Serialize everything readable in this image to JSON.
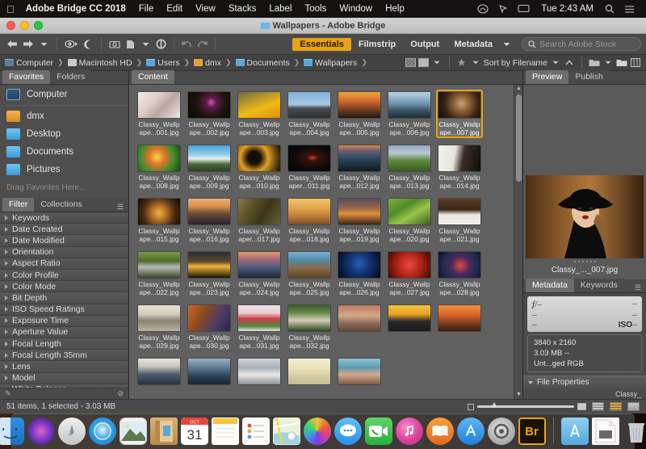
{
  "menubar": {
    "apple_icon": "apple-logo",
    "app_name": "Adobe Bridge CC 2018",
    "menus": [
      "File",
      "Edit",
      "View",
      "Stacks",
      "Label",
      "Tools",
      "Window",
      "Help"
    ],
    "status_icons": [
      "creative-cloud-icon",
      "pointer-icon",
      "airplay-icon"
    ],
    "clock": "Tue 2:43 AM",
    "search_icon": "spotlight-search-icon",
    "control_center_icon": "notification-center-icon"
  },
  "window": {
    "title": "Wallpapers - Adobe Bridge",
    "traffic_lights": [
      "close",
      "minimize",
      "zoom"
    ]
  },
  "toolbar": {
    "back_icon": "arrow-left-icon",
    "forward_icon": "arrow-right-icon",
    "recent_icon": "chevron-down-icon",
    "reveal_icon": "eye-icon",
    "boost_icon": "moon-icon",
    "camera_icon": "get-photos-camera-icon",
    "refine_icon": "refine-page-icon",
    "rotate_ccw_icon": "rotate-counterclockwise-icon",
    "rotate_cw_icon": "rotate-clockwise-icon",
    "undo_icon": "undo-arrow-icon",
    "redo_icon": "redo-arrow-icon",
    "workspaces": [
      "Essentials",
      "Filmstrip",
      "Output",
      "Metadata"
    ],
    "active_workspace": "Essentials",
    "workspace_more_icon": "chevron-down-icon",
    "search_placeholder": "Search Adobe Stock",
    "search_icon": "magnifier-icon",
    "search_value": ""
  },
  "breadcrumb": {
    "items": [
      {
        "label": "Computer",
        "icon": "computer-icon"
      },
      {
        "label": "Macintosh HD",
        "icon": "harddisk-icon"
      },
      {
        "label": "Users",
        "icon": "folder-icon"
      },
      {
        "label": "dmx",
        "icon": "home-icon"
      },
      {
        "label": "Documents",
        "icon": "folder-icon"
      },
      {
        "label": "Wallpapers",
        "icon": "folder-icon"
      }
    ],
    "separator": "❯",
    "tools": {
      "thumbnail_quality_icon": "checkered-thumbnail-icon",
      "preview_mode_icon": "preview-square-icon",
      "preview_dropdown_icon": "chevron-down-icon",
      "rating_icon": "star-filter-icon",
      "rating_dropdown_icon": "chevron-down-icon",
      "sort_label": "Sort by Filename",
      "sort_dropdown_icon": "chevron-down-icon",
      "sort_direction_icon": "chevron-up-icon",
      "new_folder_icon": "new-folder-icon",
      "new_folder_dropdown_icon": "chevron-down-icon",
      "open_folder_icon": "open-folder-icon",
      "grid_toggle_icon": "grid-layout-icon"
    }
  },
  "favorites_panel": {
    "tabs": [
      "Favorites",
      "Folders"
    ],
    "active_tab": "Favorites",
    "items": [
      {
        "label": "Computer",
        "icon": "computer-icon"
      },
      {
        "label": "dmx",
        "icon": "home-icon"
      },
      {
        "label": "Desktop",
        "icon": "folder-icon"
      },
      {
        "label": "Documents",
        "icon": "folder-icon"
      },
      {
        "label": "Pictures",
        "icon": "folder-icon"
      }
    ],
    "drag_hint": "Drag Favorites Here..."
  },
  "filter_panel": {
    "tabs": [
      "Filter",
      "Collections"
    ],
    "active_tab": "Filter",
    "menu_icon": "panel-menu-icon",
    "items": [
      "Keywords",
      "Date Created",
      "Date Modified",
      "Orientation",
      "Aspect Ratio",
      "Color Profile",
      "Color Mode",
      "Bit Depth",
      "ISO Speed Ratings",
      "Exposure Time",
      "Aperture Value",
      "Focal Length",
      "Focal Length 35mm",
      "Lens",
      "Model",
      "White Balance"
    ],
    "footer": {
      "keep_filter_icon": "pin-filter-icon",
      "clear_filter_icon": "clear-filter-icon"
    }
  },
  "content_panel": {
    "tabs": [
      "Content"
    ],
    "active_tab": "Content",
    "selected_file": "Classy_Wallpape...007.jpg",
    "scrollbar": {
      "up_icon": "scroll-up-arrow-icon",
      "down_icon": "scroll-down-arrow-icon"
    },
    "files": [
      {
        "name_line1": "Classy_Wallp",
        "name_line2": "ape...001.jpg",
        "selected": false,
        "thumb": "linear-gradient(135deg,#f4e9e4 0%,#ded0ca 35%,#b9a79f 60%,#efe7e2 100%)"
      },
      {
        "name_line1": "Classy_Wallp",
        "name_line2": "ape...002.jpg",
        "selected": false,
        "thumb": "radial-gradient(circle at 55% 40%,#d14fb0 0%,#5c1c4a 18%,#1a1208 55%,#0a0805 100%)"
      },
      {
        "name_line1": "Classy_Wallp",
        "name_line2": "ape...003.jpg",
        "selected": false,
        "thumb": "linear-gradient(160deg,#6f6a3c 0%,#b89a2a 35%,#f2b915 60%,#d98f08 100%)"
      },
      {
        "name_line1": "Classy_Wallp",
        "name_line2": "ape...004.jpg",
        "selected": false,
        "thumb": "linear-gradient(#7fb3d8 0%,#a8c9e2 48%,#4a4f54 62%,#2b2f33 100%)"
      },
      {
        "name_line1": "Classy_Wallp",
        "name_line2": "ape...005.jpg",
        "selected": false,
        "thumb": "linear-gradient(#f2a33c 0%,#c9622a 40%,#6b3a20 70%,#231711 100%)"
      },
      {
        "name_line1": "Classy_Wallp",
        "name_line2": "ape...006.jpg",
        "selected": false,
        "thumb": "linear-gradient(#b8d6e8 0%,#6f93ad 45%,#3d5668 70%,#1d2b35 100%)"
      },
      {
        "name_line1": "Classy_Wallp",
        "name_line2": "ape...007.jpg",
        "selected": true,
        "thumb": "radial-gradient(circle at 55% 45%,#c9a276 0%,#8a5f35 30%,#3a2416 62%,#120b05 100%)"
      },
      {
        "name_line1": "Classy_Wallp",
        "name_line2": "ape...008.jpg",
        "selected": false,
        "thumb": "radial-gradient(circle at 45% 45%,#f2d83c 0%,#e0732a 30%,#3f8f2c 62%,#1d3f14 100%)"
      },
      {
        "name_line1": "Classy_Wallp",
        "name_line2": "ape...009.jpg",
        "selected": false,
        "thumb": "linear-gradient(#4a9fd8 0%,#9fd0ea 38%,#e8eef2 52%,#4f6b3f 72%,#2b3d22 100%)"
      },
      {
        "name_line1": "Classy_Wallp",
        "name_line2": "ape...010.jpg",
        "selected": false,
        "thumb": "radial-gradient(circle at 38% 48%,#0a0a0a 0%,#1a1106 22%,#e0a024 48%,#6b4a10 75%,#140d04 100%)"
      },
      {
        "name_line1": "Classy_Wallp",
        "name_line2": "aper...011.jpg",
        "selected": false,
        "thumb": "radial-gradient(ellipse at 58% 48%,#cf3b2a 0%,#3a1208 16%,#0a0a0a 60%,#050505 100%)"
      },
      {
        "name_line1": "Classy_Wallp",
        "name_line2": "ape...012.jpg",
        "selected": false,
        "thumb": "linear-gradient(#d4884a 0%,#6a5a7a 22%,#2f4a5c 48%,#1d3340 72%,#0f1a22 100%)"
      },
      {
        "name_line1": "Classy_Wallp",
        "name_line2": "ape...013.jpg",
        "selected": false,
        "thumb": "linear-gradient(#8fa8bc 0%,#b9c8d4 30%,#5f8a3c 58%,#3a5a26 100%)"
      },
      {
        "name_line1": "Classy_Wallp",
        "name_line2": "ape...014.jpg",
        "selected": false,
        "thumb": "linear-gradient(100deg,#f2f2ee 0%,#e8e4dc 38%,#3a2d24 58%,#120d09 100%)"
      },
      {
        "name_line1": "Classy_Wallp",
        "name_line2": "ape...015.jpg",
        "selected": false,
        "thumb": "radial-gradient(circle at 50% 55%,#f0b63c 0%,#b9702a 28%,#4a2c12 62%,#120a04 100%)"
      },
      {
        "name_line1": "Classy_Wallp",
        "name_line2": "ape...016.jpg",
        "selected": false,
        "thumb": "linear-gradient(#e8b27a 0%,#d98f4a 30%,#6a4a3a 58%,#2b2430 100%)"
      },
      {
        "name_line1": "Classy_Wallp",
        "name_line2": "aper...017.jpg",
        "selected": false,
        "thumb": "linear-gradient(120deg,#8a7a4a 0%,#5f5228 30%,#3a3418 60%,#6b5f33 100%)"
      },
      {
        "name_line1": "Classy_Wallp",
        "name_line2": "ape...018.jpg",
        "selected": false,
        "thumb": "linear-gradient(#f0c46a 0%,#e0a04a 40%,#b97a3a 70%,#7a5228 100%)"
      },
      {
        "name_line1": "Classy_Wallp",
        "name_line2": "ape...019.jpg",
        "selected": false,
        "thumb": "linear-gradient(#5a4a5f 0%,#9a6a4a 38%,#e0903c 58%,#3a2418 100%)"
      },
      {
        "name_line1": "Classy_Wallp",
        "name_line2": "ape...020.jpg",
        "selected": false,
        "thumb": "linear-gradient(150deg,#7ab03c 0%,#4f8a2a 35%,#9ac44a 60%,#3a5f1d 100%)"
      },
      {
        "name_line1": "Classy_Wallp",
        "name_line2": "ape...021.jpg",
        "selected": false,
        "thumb": "linear-gradient(#5f3f28 0%,#3a2416 42%,#e8e4de 62%,#f2f0ec 100%)"
      },
      {
        "name_line1": "Classy_Wallp",
        "name_line2": "ape...022.jpg",
        "selected": false,
        "thumb": "linear-gradient(#7a9a4a 0%,#4f6b2a 35%,#b9b9b9 58%,#3a4a22 100%)"
      },
      {
        "name_line1": "Classy_Wallp",
        "name_line2": "ape...023.jpg",
        "selected": false,
        "thumb": "linear-gradient(#2b2b33 0%,#5f4a2a 38%,#f0b63c 55%,#1a1408 100%)"
      },
      {
        "name_line1": "Classy_Wallp",
        "name_line2": "ape...024.jpg",
        "selected": false,
        "thumb": "linear-gradient(#e09a6a 0%,#a06a7a 30%,#4a5a7a 62%,#1d2833 100%)"
      },
      {
        "name_line1": "Classy_Wallp",
        "name_line2": "ape...025.jpg",
        "selected": false,
        "thumb": "linear-gradient(#7ab0d4 0%,#4f8aa8 32%,#8a6a4a 62%,#5f4428 100%)"
      },
      {
        "name_line1": "Classy_Wallp",
        "name_line2": "ape...026.jpg",
        "selected": false,
        "thumb": "radial-gradient(circle at 50% 45%,#2a5fb0 0%,#153a7a 35%,#0a1a3f 75%,#050a1a 100%)"
      },
      {
        "name_line1": "Classy_Wallp",
        "name_line2": "ape...027.jpg",
        "selected": false,
        "thumb": "radial-gradient(circle at 50% 50%,#e84a3c 0%,#b92a1d 40%,#7a140a 75%,#3a0805 100%)"
      },
      {
        "name_line1": "Classy_Wallp",
        "name_line2": "ape...028.jpg",
        "selected": false,
        "thumb": "radial-gradient(circle at 52% 52%,#e84a3c 0%,#4a2a5f 35%,#1d2a4a 70%,#0a1022 100%)"
      },
      {
        "name_line1": "Classy_Wallp",
        "name_line2": "ape...029.jpg",
        "selected": false,
        "thumb": "linear-gradient(#e8e2d4 0%,#d4ccb9 35%,#8a8272 60%,#b9b2a0 100%)"
      },
      {
        "name_line1": "Classy_Wallp",
        "name_line2": "ape...030.jpg",
        "selected": false,
        "thumb": "linear-gradient(120deg,#c96a2a 0%,#8a4a1d 35%,#4a3a6b 70%,#2b2440 100%)"
      },
      {
        "name_line1": "Classy_Wallp",
        "name_line2": "ape...031.jpg",
        "selected": false,
        "thumb": "linear-gradient(#f2e4e8 0%,#e8ccd4 30%,#d43c4a 52%,#4a8a3c 80%,#f0e0e4 100%)"
      },
      {
        "name_line1": "Classy_Wallp",
        "name_line2": "ape...032.jpg",
        "selected": false,
        "thumb": "linear-gradient(#3a5f2a 0%,#6b8a4a 30%,#d4ccb9 58%,#2b4a1d 100%)"
      },
      {
        "name_line1": "",
        "name_line2": "",
        "selected": false,
        "thumb": "linear-gradient(#b97a5f 0%,#d4a88a 40%,#8a6a5a 70%,#5f4a3c 100%)"
      },
      {
        "name_line1": "",
        "name_line2": "",
        "selected": false,
        "thumb": "linear-gradient(#f2c43c 0%,#e8a024 35%,#2b2b2b 62%,#1a1a1a 100%)"
      },
      {
        "name_line1": "",
        "name_line2": "",
        "selected": false,
        "thumb": "linear-gradient(#f0903c 0%,#d4622a 38%,#7a3a1d 70%,#3a1d0f 100%)"
      },
      {
        "name_line1": "",
        "name_line2": "",
        "selected": false,
        "thumb": "linear-gradient(#e8e4dc 0%,#c9c4b9 30%,#4a5a6b 62%,#2b3440 100%)"
      },
      {
        "name_line1": "",
        "name_line2": "",
        "selected": false,
        "thumb": "linear-gradient(#9ab0c4 0%,#5f7a94 35%,#2b3f52 70%,#1a2633 100%)"
      },
      {
        "name_line1": "",
        "name_line2": "",
        "selected": false,
        "thumb": "linear-gradient(#cfd4d8 0%,#a8b0b9 35%,#e8e8e4 62%,#8a9099 100%)"
      },
      {
        "name_line1": "",
        "name_line2": "",
        "selected": false,
        "thumb": "linear-gradient(#f2eed4 0%,#e8e0b9 40%,#d4ccA0 70%,#c4bc94 100%)"
      },
      {
        "name_line1": "",
        "name_line2": "",
        "selected": false,
        "thumb": "linear-gradient(#8ac4d4 0%,#5f9ab0 35%,#d4a88a 62%,#7a5a4a 100%)"
      }
    ]
  },
  "preview_panel": {
    "tabs": [
      "Preview",
      "Publish"
    ],
    "active_tab": "Preview",
    "caption": "Classy_..._007.jpg",
    "image_desc": "woman-in-black-hat-portrait"
  },
  "metadata_panel": {
    "tabs": [
      "Metadata",
      "Keywords"
    ],
    "active_tab": "Metadata",
    "menu_icon": "panel-menu-icon",
    "exif_placeholder": {
      "aperture": "f/",
      "aperture_value": "--",
      "shutter": "--",
      "row2_left": "--",
      "row2_right": "--",
      "row3_left": "--",
      "iso_label": "ISO",
      "iso_value": "--"
    },
    "file_info": [
      "3840 x 2160",
      "3.03 MB  --",
      "Unt...ged RGB"
    ],
    "sections": [
      {
        "label": "File Properties",
        "expanded": true
      }
    ],
    "first_row_value": "Classy_",
    "footer": {
      "clear_icon": "clear-metadata-icon",
      "apply_icon": "apply-checkmark-icon"
    }
  },
  "statusbar": {
    "text": "51 items, 1 selected - 3.03 MB",
    "thumbnail_slider": {
      "small_icon": "small-thumbnail-icon",
      "large_icon": "large-thumbnail-icon",
      "value_percent": 14
    },
    "view_modes": [
      {
        "name": "grid-view",
        "active": false
      },
      {
        "name": "details-view",
        "active": true
      },
      {
        "name": "list-view",
        "active": false
      }
    ]
  },
  "dock": {
    "items": [
      {
        "name": "finder",
        "label": "Finder",
        "running": true
      },
      {
        "name": "siri",
        "label": "Siri",
        "running": false
      },
      {
        "name": "launchpad",
        "label": "Launchpad",
        "running": false
      },
      {
        "name": "safari",
        "label": "Safari",
        "running": false
      },
      {
        "name": "mail",
        "label": "Mail",
        "running": false
      },
      {
        "name": "contacts",
        "label": "Contacts",
        "running": false
      },
      {
        "name": "calendar",
        "label": "Calendar",
        "running": false,
        "month": "OCT",
        "day": "31"
      },
      {
        "name": "notes",
        "label": "Notes",
        "running": false
      },
      {
        "name": "reminders",
        "label": "Reminders",
        "running": false
      },
      {
        "name": "maps",
        "label": "Maps",
        "running": false
      },
      {
        "name": "photos",
        "label": "Photos",
        "running": false
      },
      {
        "name": "messages",
        "label": "Messages",
        "running": false
      },
      {
        "name": "facetime",
        "label": "FaceTime",
        "running": false
      },
      {
        "name": "itunes",
        "label": "iTunes",
        "running": false
      },
      {
        "name": "ibooks",
        "label": "iBooks",
        "running": false
      },
      {
        "name": "appstore",
        "label": "App Store",
        "running": false
      },
      {
        "name": "system-preferences",
        "label": "System Preferences",
        "running": false
      },
      {
        "name": "adobe-bridge",
        "label": "Br",
        "running": true
      }
    ],
    "right_items": [
      {
        "name": "applications-folder",
        "label": "Applications"
      },
      {
        "name": "documents-stack",
        "label": "Documents"
      },
      {
        "name": "trash",
        "label": "Trash"
      }
    ]
  },
  "colors": {
    "accent": "#e8a317",
    "window_bg": "#3d3d3d",
    "panel_bg": "#4a4a4a",
    "content_bg": "#606060"
  }
}
